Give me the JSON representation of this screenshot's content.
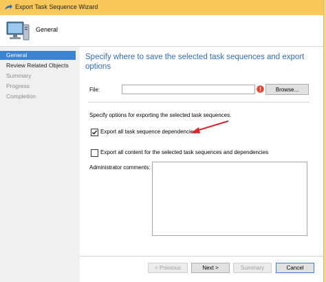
{
  "window": {
    "title": "Export Task Sequence Wizard",
    "title_icon": "wizard-arrow-icon"
  },
  "header": {
    "title": "General",
    "icon": "computer-icon"
  },
  "sidebar": {
    "items": [
      {
        "label": "General",
        "state": "active"
      },
      {
        "label": "Review Related Objects",
        "state": "normal"
      },
      {
        "label": "Summary",
        "state": "disabled"
      },
      {
        "label": "Progress",
        "state": "disabled"
      },
      {
        "label": "Completion",
        "state": "disabled"
      }
    ]
  },
  "main": {
    "heading": "Specify where to save the selected task sequences and export options",
    "file": {
      "label": "File:",
      "value": "",
      "error_icon": "error-icon"
    },
    "browse_label": "Browse...",
    "options_text": "Specify options for exporting the selected task sequences.",
    "checkbox_dependencies": {
      "label": "Export all task sequence dependencies",
      "checked": true
    },
    "checkbox_content": {
      "label": "Export all content for the selected task sequences and dependencies",
      "checked": false
    },
    "admin_comments_label": "Administrator comments:",
    "admin_comments_value": ""
  },
  "footer": {
    "previous_label": "< Previous",
    "next_label": "Next >",
    "summary_label": "Summary",
    "cancel_label": "Cancel"
  },
  "colors": {
    "titlebar": "#f8c95a",
    "selected_nav": "#3c83d1",
    "heading_blue": "#2f6eb5",
    "annotation_arrow": "#d9262b"
  }
}
